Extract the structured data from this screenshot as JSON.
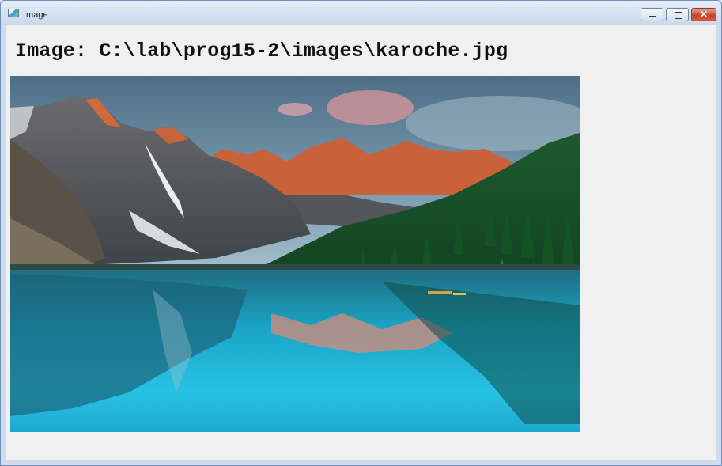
{
  "window": {
    "title": "Image",
    "icon": "app-window-icon",
    "controls": {
      "minimize": "minimize-icon",
      "maximize": "maximize-icon",
      "close": "close-icon"
    }
  },
  "content": {
    "caption": "Image: C:\\lab\\prog15-2\\images\\karoche.jpg"
  },
  "colors": {
    "client_bg": "#f0f0f0",
    "titlebar": "#d5e1f0",
    "close_button": "#c8452e"
  }
}
